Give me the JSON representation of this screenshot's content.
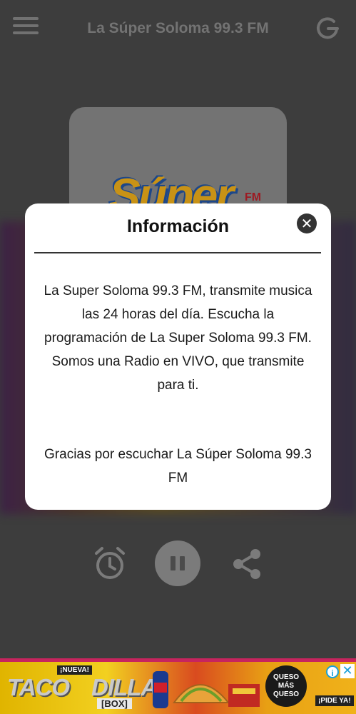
{
  "app": {
    "title": "La Súper Soloma 99.3 FM"
  },
  "album": {
    "logo_text": "Súper",
    "logo_fm": "FM"
  },
  "dialog": {
    "title": "Información",
    "close_glyph": "✕",
    "body": "La Super Soloma 99.3 FM, transmite musica las 24 horas del día. Escucha la programación de La Super Soloma 99.3 FM. Somos una Radio en VIVO, que transmite para ti.",
    "thanks": "Gracias por escuchar La Súper Soloma 99.3 FM"
  },
  "controls": {
    "alarm_icon": "alarm-clock-icon",
    "play_state": "pause",
    "share_icon": "share-icon"
  },
  "ad": {
    "badge_new": "¡NUEVA!",
    "brand_part1": "TACO",
    "brand_part2": "DILLA",
    "brand_box": "[BOX]",
    "promo": "QUESO MÁS QUESO",
    "cta": "¡PIDE YA!",
    "info_glyph": "i",
    "close_glyph": "✕"
  },
  "colors": {
    "background": "#4b4b4b",
    "dialog": "#ffffff",
    "icon_gray": "#8a8a8a",
    "ad_accent": "#1aa0d8"
  }
}
